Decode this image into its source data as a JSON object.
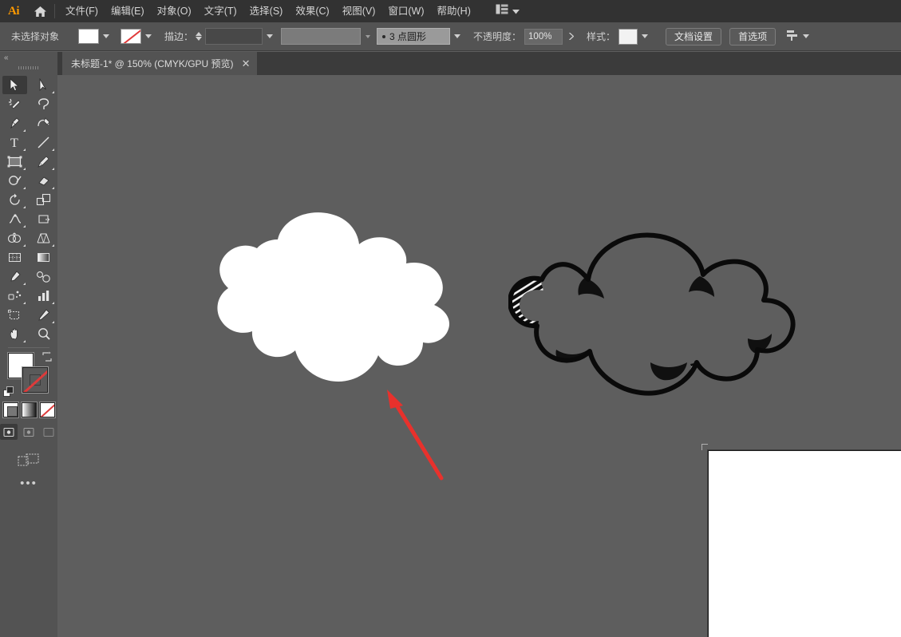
{
  "app": {
    "name": "Adobe Illustrator",
    "logo_text": "Ai",
    "logo_color": "#ff9a00"
  },
  "menubar": {
    "home_icon": "home-icon",
    "items": [
      {
        "label": "文件(F)"
      },
      {
        "label": "编辑(E)"
      },
      {
        "label": "对象(O)"
      },
      {
        "label": "文字(T)"
      },
      {
        "label": "选择(S)"
      },
      {
        "label": "效果(C)"
      },
      {
        "label": "视图(V)"
      },
      {
        "label": "窗口(W)"
      },
      {
        "label": "帮助(H)"
      }
    ],
    "workspace_switcher": {
      "icon": "workspace-layout-icon",
      "caret": "chevron-down-icon"
    }
  },
  "optionsbar": {
    "selection_status": "未选择对象",
    "fill": {
      "label": "fill-swatch",
      "color": "#ffffff",
      "caret": "chevron-down-icon"
    },
    "stroke_color": {
      "label": "stroke-swatch",
      "value": "无",
      "caret": "chevron-down-icon"
    },
    "stroke_label": "描边：",
    "stroke_weight": "",
    "stroke_weight_caret": "chevron-down-icon",
    "variable_width_caret": "chevron-down-icon",
    "brush_profile": "3 点圆形",
    "brush_profile_caret": "chevron-down-icon",
    "opacity_label": "不透明度：",
    "opacity_value": "100%",
    "opacity_caret": "chevron-right-icon",
    "style_label": "样式：",
    "style_caret": "chevron-down-icon",
    "document_setup_button": "文档设置",
    "preferences_button": "首选项",
    "align_menu_icon": "align-icon",
    "align_menu_caret": "chevron-down-icon"
  },
  "tabbar": {
    "tabs": [
      {
        "title": "未标题-1* @ 150% (CMYK/GPU 预览)",
        "close_icon": "close-icon",
        "active": true
      }
    ]
  },
  "toolbar": {
    "collapse_icon": "double-chevron-left-icon",
    "grip_icon": "drag-grip-icon",
    "tools": [
      {
        "name": "selection-tool",
        "label": "选择工具",
        "active": true,
        "has_flyout": false
      },
      {
        "name": "direct-selection-tool",
        "label": "直接选择工具",
        "active": false,
        "has_flyout": true
      },
      {
        "name": "magic-wand-tool",
        "label": "魔棒工具",
        "active": false,
        "has_flyout": false
      },
      {
        "name": "lasso-tool",
        "label": "套索工具",
        "active": false,
        "has_flyout": false
      },
      {
        "name": "pen-tool",
        "label": "钢笔工具",
        "active": false,
        "has_flyout": true
      },
      {
        "name": "curvature-tool",
        "label": "曲率工具",
        "active": false,
        "has_flyout": false
      },
      {
        "name": "type-tool",
        "label": "文字工具",
        "active": false,
        "has_flyout": true
      },
      {
        "name": "line-segment-tool",
        "label": "直线段工具",
        "active": false,
        "has_flyout": true
      },
      {
        "name": "rectangle-tool",
        "label": "矩形工具",
        "active": false,
        "has_flyout": true
      },
      {
        "name": "paintbrush-tool",
        "label": "画笔工具",
        "active": false,
        "has_flyout": true
      },
      {
        "name": "shaper-tool",
        "label": "Shaper 工具",
        "active": false,
        "has_flyout": true
      },
      {
        "name": "eraser-tool",
        "label": "橡皮擦工具",
        "active": false,
        "has_flyout": true
      },
      {
        "name": "rotate-tool",
        "label": "旋转工具",
        "active": false,
        "has_flyout": true
      },
      {
        "name": "scale-tool",
        "label": "比例缩放工具",
        "active": false,
        "has_flyout": true
      },
      {
        "name": "width-tool",
        "label": "宽度工具",
        "active": false,
        "has_flyout": true
      },
      {
        "name": "free-transform-tool",
        "label": "自由变换工具",
        "active": false,
        "has_flyout": false
      },
      {
        "name": "shape-builder-tool",
        "label": "形状生成器工具",
        "active": false,
        "has_flyout": true
      },
      {
        "name": "perspective-grid-tool",
        "label": "透视网格工具",
        "active": false,
        "has_flyout": true
      },
      {
        "name": "mesh-tool",
        "label": "网格工具",
        "active": false,
        "has_flyout": false
      },
      {
        "name": "gradient-tool",
        "label": "渐变工具",
        "active": false,
        "has_flyout": false
      },
      {
        "name": "eyedropper-tool",
        "label": "吸管工具",
        "active": false,
        "has_flyout": true
      },
      {
        "name": "blend-tool",
        "label": "混合工具",
        "active": false,
        "has_flyout": false
      },
      {
        "name": "symbol-sprayer-tool",
        "label": "符号喷枪工具",
        "active": false,
        "has_flyout": true
      },
      {
        "name": "column-graph-tool",
        "label": "柱形图工具",
        "active": false,
        "has_flyout": true
      },
      {
        "name": "artboard-tool",
        "label": "画板工具",
        "active": false,
        "has_flyout": false
      },
      {
        "name": "slice-tool",
        "label": "切片工具",
        "active": false,
        "has_flyout": true
      },
      {
        "name": "hand-tool",
        "label": "抓手工具",
        "active": false,
        "has_flyout": true
      },
      {
        "name": "zoom-tool",
        "label": "缩放工具",
        "active": false,
        "has_flyout": false
      }
    ],
    "fill_stroke": {
      "fill_color": "#ffffff",
      "stroke_value": "无",
      "swap_icon": "swap-fill-stroke-icon",
      "default_icon": "default-fill-stroke-icon"
    },
    "color_modes": [
      {
        "name": "color-mode-flat-button",
        "label": "颜色"
      },
      {
        "name": "color-mode-gradient-button",
        "label": "渐变"
      },
      {
        "name": "color-mode-none-button",
        "label": "无"
      }
    ],
    "screen_modes": [
      {
        "name": "screen-mode-normal-button",
        "label": "正常屏幕模式",
        "active": true
      },
      {
        "name": "screen-mode-fullmenu-button",
        "label": "带有菜单栏的全屏模式",
        "active": false
      },
      {
        "name": "screen-mode-full-button",
        "label": "全屏模式",
        "active": false
      }
    ],
    "edit_toolbar_icon": "edit-toolbar-icon",
    "more_icon": "more-options-icon"
  },
  "canvas": {
    "background_color": "#5e5e5e",
    "zoom": "150%",
    "artwork": [
      {
        "name": "white-cloud-shape",
        "description": "白色填充云朵形状",
        "fill": "#ffffff",
        "stroke": "无"
      },
      {
        "name": "sketch-cloud-shape",
        "description": "黑色手绘轮廓云朵形状（带阴影排线）",
        "fill": "无",
        "stroke": "#000000"
      }
    ],
    "annotation": {
      "name": "red-arrow-annotation",
      "color": "#e8312c",
      "points_to": "white-cloud-shape"
    },
    "artboard": {
      "name": "artboard-1",
      "fill": "#ffffff"
    }
  }
}
